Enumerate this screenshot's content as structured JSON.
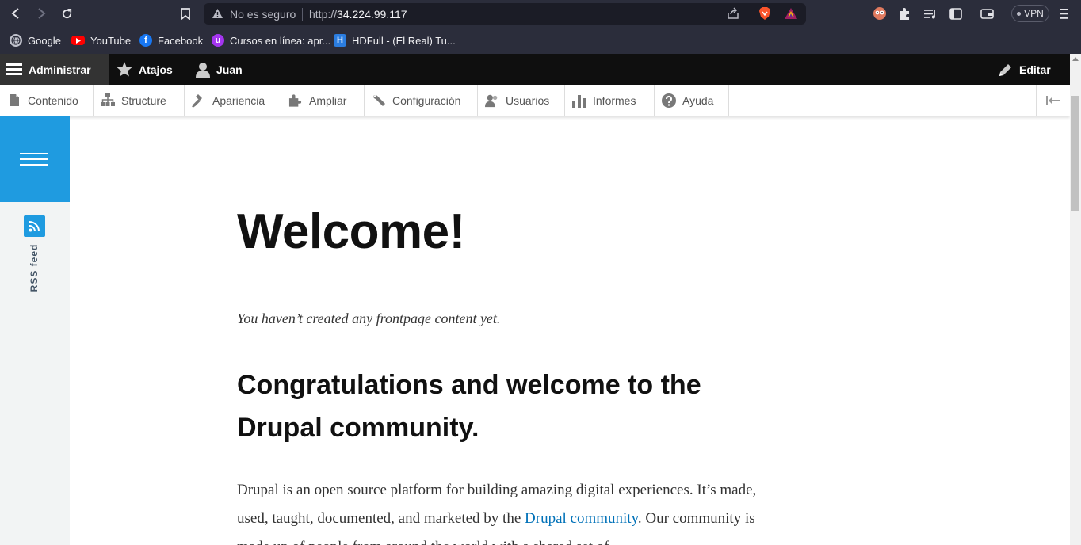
{
  "browser": {
    "address_insecure": "No es seguro",
    "url_prefix": "http://",
    "url_host": "34.224.99.117",
    "vpn_label": "VPN"
  },
  "bookmarks": [
    {
      "label": "Google"
    },
    {
      "label": "YouTube"
    },
    {
      "label": "Facebook"
    },
    {
      "label": "Cursos en línea: apr..."
    },
    {
      "label": "HDFull - (El Real) Tu..."
    }
  ],
  "toolbar": {
    "admin": "Administrar",
    "shortcuts": "Atajos",
    "user": "Juan",
    "edit": "Editar"
  },
  "tray": [
    {
      "label": "Contenido",
      "icon": "file-icon"
    },
    {
      "label": "Structure",
      "icon": "sitemap-icon"
    },
    {
      "label": "Apariencia",
      "icon": "paintbrush-icon"
    },
    {
      "label": "Ampliar",
      "icon": "puzzle-icon"
    },
    {
      "label": "Configuración",
      "icon": "wrench-icon"
    },
    {
      "label": "Usuarios",
      "icon": "people-icon"
    },
    {
      "label": "Informes",
      "icon": "bar-chart-icon"
    },
    {
      "label": "Ayuda",
      "icon": "help-icon"
    }
  ],
  "sidebar": {
    "rss_label": "RSS feed"
  },
  "main": {
    "title": "Welcome!",
    "empty_message": "You haven’t created any frontpage content yet.",
    "heading": "Congratulations and welcome to the Drupal community.",
    "paragraph_before_link": "Drupal is an open source platform for building amazing digital experiences. It’s made, used, taught, documented, and marketed by the ",
    "link_text": "Drupal community",
    "paragraph_after_link": ". Our community is made up of people from around the world with a shared set of"
  },
  "colors": {
    "browser_bg": "#2b2d3b",
    "toolbar_bg": "#0f0f0f",
    "accent_blue": "#1f9be0",
    "link": "#0071b8"
  }
}
